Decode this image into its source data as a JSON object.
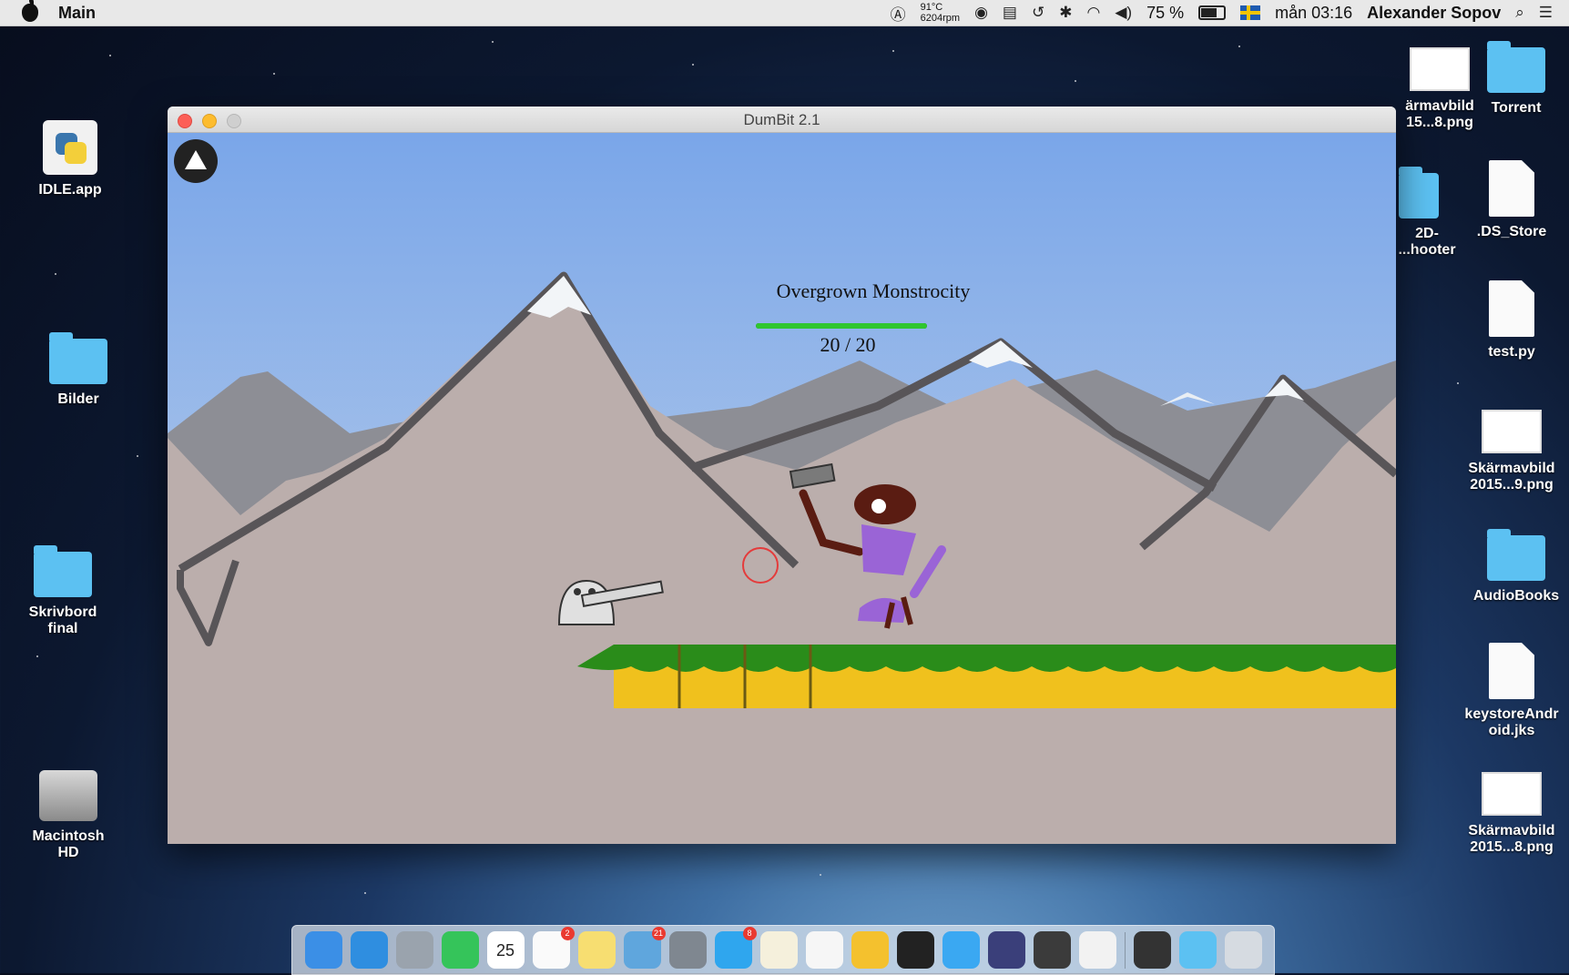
{
  "menubar": {
    "app_name": "Main",
    "temperature": "91°C",
    "fan_speed": "6204rpm",
    "battery": "75 %",
    "datetime": "mån 03:16",
    "user": "Alexander Sopov",
    "icons": [
      "adobe-icon",
      "record-icon",
      "memory-icon",
      "time-machine-icon",
      "bluetooth-icon",
      "wifi-icon",
      "volume-icon",
      "battery-icon",
      "flag-icon",
      "spotlight-icon",
      "notification-center-icon"
    ]
  },
  "desktop_left": [
    {
      "label": "IDLE.app",
      "icon": "python-idle-icon"
    },
    {
      "label": "Bilder",
      "icon": "folder-icon"
    },
    {
      "label": "Skrivbord final",
      "icon": "folder-icon"
    },
    {
      "label": "Macintosh HD",
      "icon": "hard-disk-icon"
    }
  ],
  "desktop_right": [
    {
      "label": "ärmavbild 15...8.png",
      "icon": "screenshot-thumbnail-icon"
    },
    {
      "label": "Torrent",
      "icon": "folder-icon"
    },
    {
      "label": "2D- ...hooter",
      "icon": "folder-icon"
    },
    {
      "label": ".DS_Store",
      "icon": "document-icon"
    },
    {
      "label": "test.py",
      "icon": "python-file-icon"
    },
    {
      "label": "Skärmavbild 2015...9.png",
      "icon": "screenshot-thumbnail-icon"
    },
    {
      "label": "AudioBooks",
      "icon": "folder-icon"
    },
    {
      "label": "keystoreAndroid.jks",
      "icon": "document-icon"
    },
    {
      "label": "Skärmavbild 2015...8.png",
      "icon": "screenshot-thumbnail-icon"
    }
  ],
  "window": {
    "title": "DumBit 2.1"
  },
  "game": {
    "boss_name": "Overgrown Monstrocity",
    "boss_hp_current": 20,
    "boss_hp_max": 20,
    "boss_hp_text": "20 / 20",
    "boss_health_fraction": 1.0,
    "colors": {
      "sky_top": "#7aa6e9",
      "sky_bottom": "#c9d8ea",
      "mountain": "#bbaeac",
      "mountain_outline": "#585558",
      "health_bar": "#2fc62f",
      "grass": "#2a8c1a",
      "ground": "#f0c11d",
      "boss_body": "#5a1c12",
      "boss_clothes": "#9a64d6",
      "crosshair": "#e43b3b"
    },
    "up_button_icon": "triangle-up-icon"
  },
  "dock": {
    "apps": [
      {
        "name": "finder-icon",
        "color": "#3b8fe6"
      },
      {
        "name": "safari-icon",
        "color": "#2f8ee0"
      },
      {
        "name": "launchpad-icon",
        "color": "#9aa3ad"
      },
      {
        "name": "facetime-icon",
        "color": "#35c45a"
      },
      {
        "name": "calendar-icon",
        "color": "#ffffff",
        "text": "25"
      },
      {
        "name": "reminders-icon",
        "color": "#fafafa",
        "badge": "2"
      },
      {
        "name": "notes-icon",
        "color": "#f7de71"
      },
      {
        "name": "mail-icon",
        "color": "#5fa6dd",
        "badge": "21"
      },
      {
        "name": "system-preferences-icon",
        "color": "#7f8790"
      },
      {
        "name": "app-store-icon",
        "color": "#2fa6ee",
        "badge": "8"
      },
      {
        "name": "textedit-icon",
        "color": "#f5f0dc"
      },
      {
        "name": "photos-icon",
        "color": "#f6f6f6"
      },
      {
        "name": "winter-app-icon",
        "color": "#f4c12e"
      },
      {
        "name": "terminal-icon",
        "color": "#222222"
      },
      {
        "name": "messages-icon",
        "color": "#3aa8f2"
      },
      {
        "name": "eclipse-icon",
        "color": "#3a3f7a"
      },
      {
        "name": "quicktime-icon",
        "color": "#3b3b3b"
      },
      {
        "name": "java-icon",
        "color": "#f2f2f2"
      },
      {
        "name": "screen-capture-icon",
        "color": "#333333"
      },
      {
        "name": "downloads-folder-icon",
        "color": "#5cc1f2"
      },
      {
        "name": "trash-icon",
        "color": "#d6dbe1"
      }
    ]
  }
}
